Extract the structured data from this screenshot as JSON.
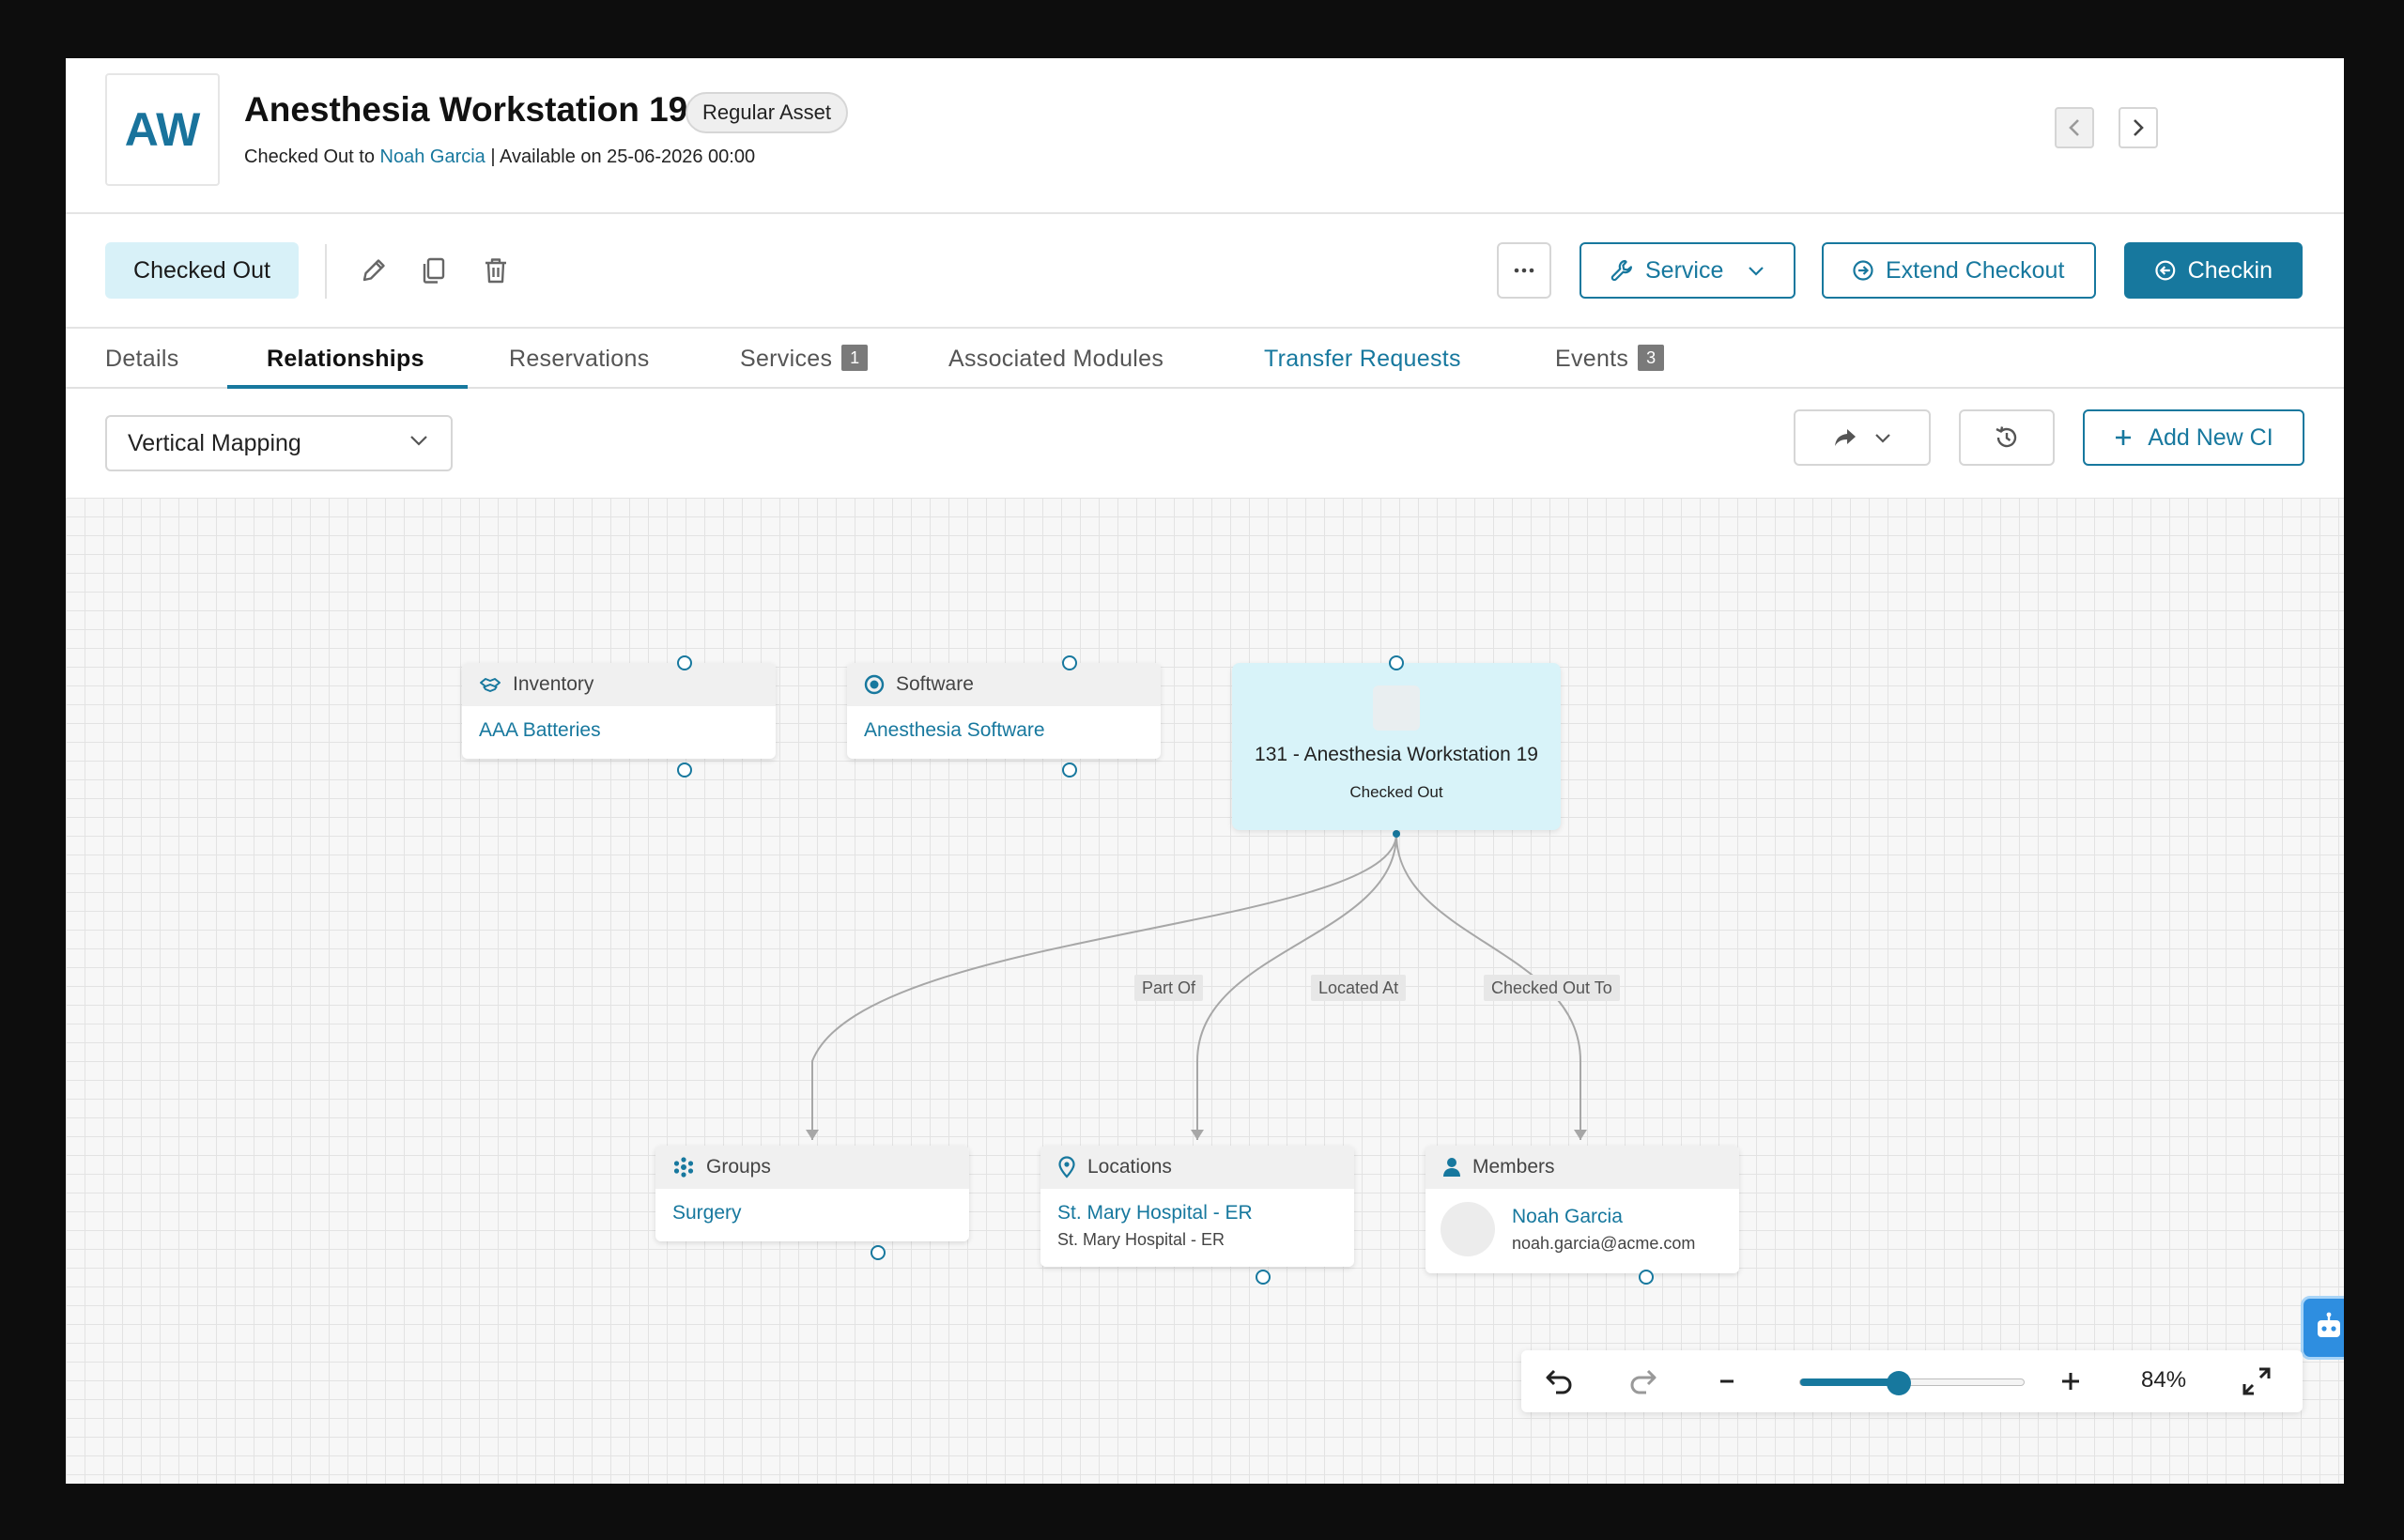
{
  "header": {
    "avatar_initials": "AW",
    "title": "Anesthesia Workstation 19",
    "badge": "Regular Asset",
    "checked_out_prefix": "Checked Out to",
    "checked_out_to": "Noah Garcia",
    "available_text": "| Available on 25-06-2026 00:00"
  },
  "actions": {
    "status": "Checked Out",
    "service_label": "Service",
    "extend_label": "Extend Checkout",
    "checkin_label": "Checkin"
  },
  "tabs": [
    {
      "label": "Details"
    },
    {
      "label": "Relationships",
      "active": true
    },
    {
      "label": "Reservations"
    },
    {
      "label": "Services",
      "count": "1"
    },
    {
      "label": "Associated Modules"
    },
    {
      "label": "Transfer Requests"
    },
    {
      "label": "Events",
      "count": "3"
    }
  ],
  "toolbar": {
    "mapping_value": "Vertical Mapping",
    "add_ci_label": "Add New CI"
  },
  "graph": {
    "center": {
      "name": "131 - Anesthesia Workstation 19",
      "status": "Checked Out"
    },
    "top_nodes": [
      {
        "type": "Inventory",
        "icon": "inventory-icon",
        "item": "AAA Batteries"
      },
      {
        "type": "Software",
        "icon": "software-icon",
        "item": "Anesthesia Software"
      }
    ],
    "bottom_nodes": [
      {
        "type": "Groups",
        "icon": "groups-icon",
        "item": "Surgery"
      },
      {
        "type": "Locations",
        "icon": "location-pin-icon",
        "item": "St. Mary Hospital - ER",
        "sub": "St. Mary Hospital - ER"
      },
      {
        "type": "Members",
        "icon": "user-icon",
        "item": "Noah Garcia",
        "sub": "noah.garcia@acme.com"
      }
    ],
    "edge_labels": [
      "Part Of",
      "Located At",
      "Checked Out To"
    ]
  },
  "zoom": {
    "value_text": "84%",
    "level": 0.44
  },
  "colors": {
    "accent": "#17789e",
    "status_bg": "#d8f1f8",
    "center_node_bg": "#d8f3f9"
  }
}
